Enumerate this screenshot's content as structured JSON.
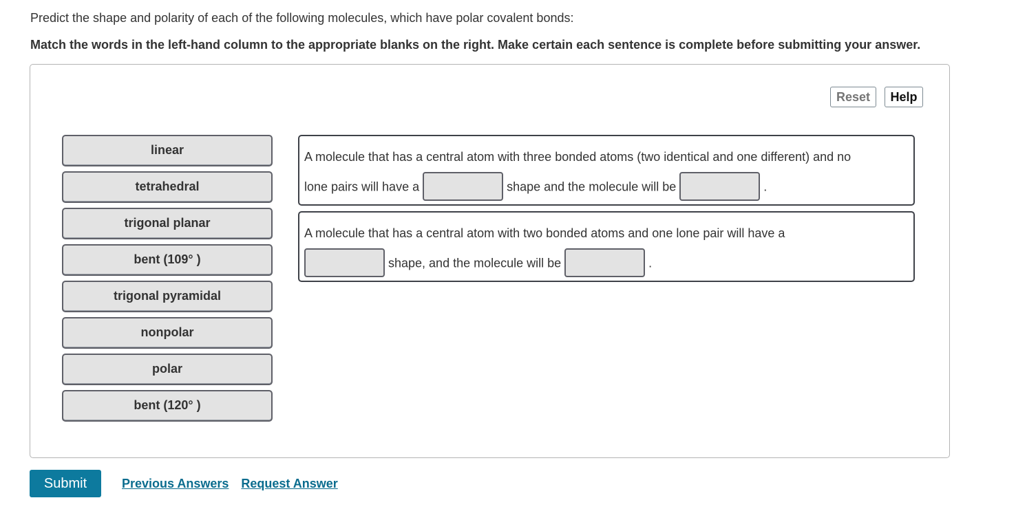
{
  "prompt": "Predict the shape and polarity of each of the following molecules, which have polar covalent bonds:",
  "instructions": "Match the words in the left-hand column to the appropriate blanks on the right. Make certain each sentence is complete before submitting your answer.",
  "toolbar": {
    "reset_label": "Reset",
    "help_label": "Help"
  },
  "word_bank": [
    {
      "label": "linear"
    },
    {
      "label": "tetrahedral"
    },
    {
      "label": "trigonal planar"
    },
    {
      "label": "bent (109° )"
    },
    {
      "label": "trigonal pyramidal"
    },
    {
      "label": "nonpolar"
    },
    {
      "label": "polar"
    },
    {
      "label": "bent (120° )"
    }
  ],
  "sentences": [
    {
      "line1": "A molecule that has a central atom with three bonded atoms (two identical and one different) and no",
      "part_a": "lone pairs will have a",
      "part_b": "shape and the molecule will be",
      "part_c": ".",
      "blanks": [
        "",
        ""
      ]
    },
    {
      "line1": "A molecule that has a central atom with two bonded atoms and one lone pair will have a",
      "part_b": "shape, and the molecule will be",
      "part_c": ".",
      "blanks": [
        "",
        ""
      ]
    }
  ],
  "footer": {
    "submit_label": "Submit",
    "previous_answers_label": "Previous Answers",
    "request_answer_label": "Request Answer"
  },
  "colors": {
    "submit_bg": "#0d7a9e",
    "link": "#0a6c8e",
    "chip_bg": "#e3e3e3"
  }
}
